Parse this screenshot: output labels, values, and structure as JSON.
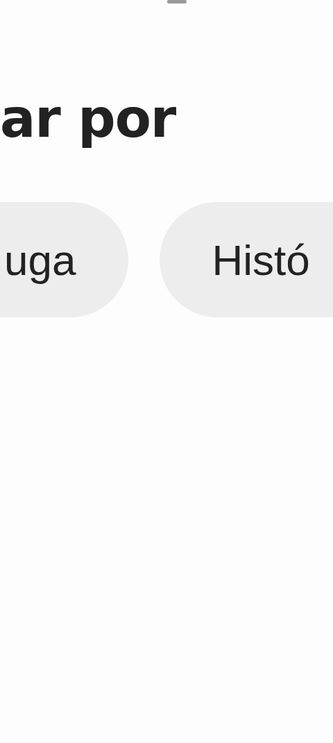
{
  "heading": "ar por",
  "chips": [
    {
      "label": "uga",
      "kind": "cut-left"
    },
    {
      "label": "Histó",
      "kind": "cut-right"
    }
  ]
}
